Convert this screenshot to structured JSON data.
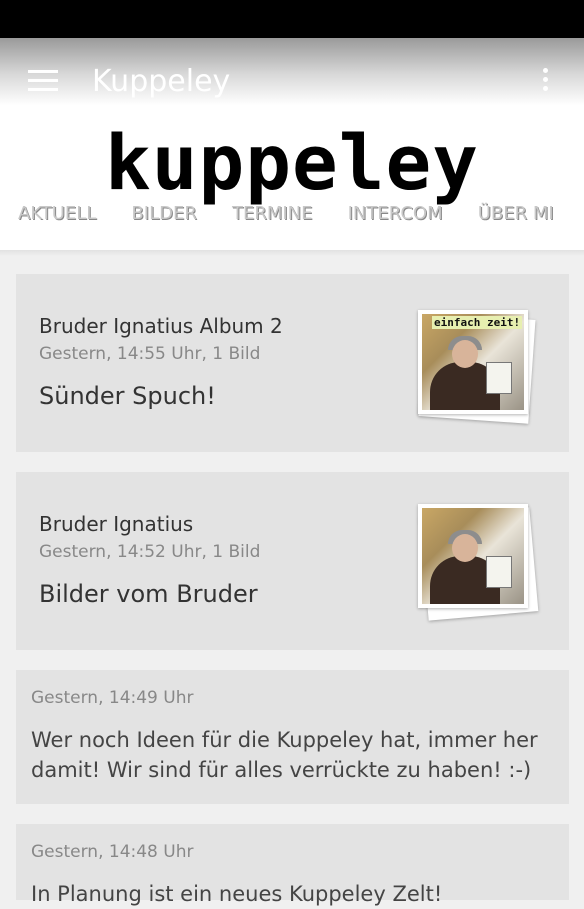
{
  "app": {
    "title": "Kuppeley",
    "logo": "kuppeley"
  },
  "tabs": [
    {
      "label": "AKTUELL"
    },
    {
      "label": "BILDER"
    },
    {
      "label": "TERMINE"
    },
    {
      "label": "INTERCOM"
    },
    {
      "label": "ÜBER MI"
    }
  ],
  "posts": [
    {
      "title": "Bruder Ignatius Album 2",
      "meta": "Gestern, 14:55 Uhr, 1 Bild",
      "caption": "Sünder Spuch!",
      "photo_label": "einfach zeit!"
    },
    {
      "title": "Bruder Ignatius",
      "meta": "Gestern, 14:52 Uhr, 1 Bild",
      "caption": "Bilder vom Bruder",
      "photo_label": ""
    }
  ],
  "messages": [
    {
      "timestamp": "Gestern, 14:49 Uhr",
      "text_line1": "Wer noch Ideen für die Kuppeley hat, immer her",
      "text_line2": "damit! Wir sind für alles verrückte zu haben! :-)"
    },
    {
      "timestamp": "Gestern, 14:48 Uhr",
      "text_line1": "In Planung ist ein neues Kuppeley Zelt!"
    }
  ],
  "icons": {
    "menu": "hamburger-menu-icon",
    "overflow": "overflow-menu-icon"
  },
  "colors": {
    "card_background": "#e3e3e3",
    "page_background": "#f0f0f0",
    "tab_text": "#c8c8c8"
  }
}
